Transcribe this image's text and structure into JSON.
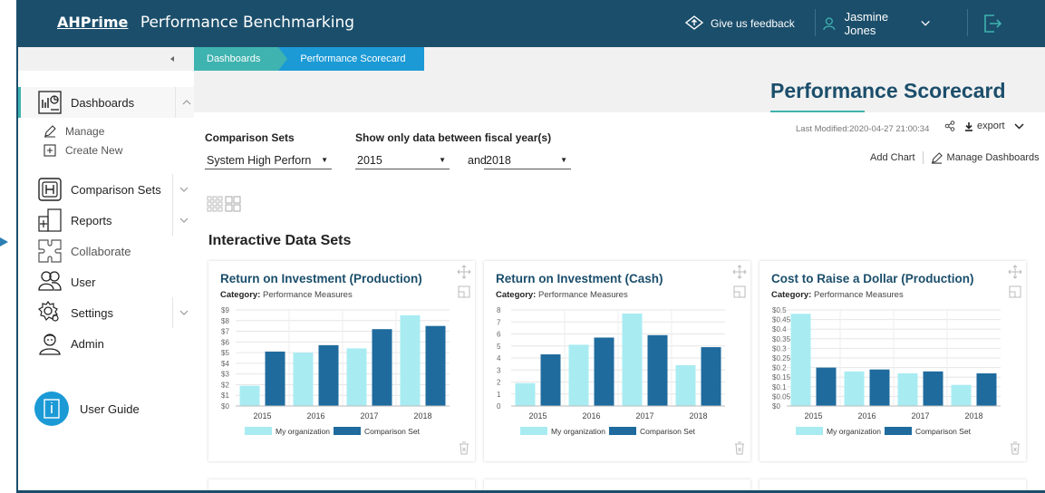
{
  "header": {
    "brand_logo": "AHPrime",
    "app_title": "Performance Benchmarking",
    "feedback_label": "Give us feedback",
    "user_name": "Jasmine Jones"
  },
  "breadcrumb": [
    "Dashboards",
    "Performance Scorecard"
  ],
  "sidebar": {
    "dashboards_label": "Dashboards",
    "manage_label": "Manage",
    "create_new_label": "Create New",
    "comparison_sets_label": "Comparison Sets",
    "reports_label": "Reports",
    "collaborate_label": "Collaborate",
    "user_label": "User",
    "settings_label": "Settings",
    "admin_label": "Admin",
    "user_guide_label": "User Guide"
  },
  "page": {
    "title": "Performance Scorecard",
    "last_modified": "Last Modified:2020-04-27 21:00:34",
    "export_label": "export",
    "add_chart_label": "Add Chart",
    "manage_dashboards_label": "Manage Dashboards",
    "section_title": "Interactive Data Sets"
  },
  "filters": {
    "comparison_label": "Comparison Sets",
    "comparison_value": "System High Perforn",
    "year_label": "Show only data between fiscal year(s)",
    "year_from": "2015",
    "and_label": "and",
    "year_to": "2018"
  },
  "colors": {
    "header": "#1b4e6b",
    "teal": "#3fb3b0",
    "blue": "#1b9ad6",
    "my_org": "#a8ecf2",
    "comparison": "#1f6b9e"
  },
  "chart_data": [
    {
      "type": "bar",
      "title": "Return on Investment (Production)",
      "category_label": "Category:",
      "category_value": "Performance Measures",
      "categories": [
        "2015",
        "2016",
        "2017",
        "2018"
      ],
      "series": [
        {
          "name": "My organization",
          "values": [
            1.9,
            5.0,
            5.4,
            8.5
          ]
        },
        {
          "name": "Comparison Set",
          "values": [
            5.1,
            5.7,
            7.2,
            7.5
          ]
        }
      ],
      "ylim": [
        0,
        9
      ],
      "yticks": [
        0,
        1,
        2,
        3,
        4,
        5,
        6,
        7,
        8,
        9
      ],
      "ytick_labels": [
        "$0",
        "$1",
        "$2",
        "$3",
        "$4",
        "$5",
        "$6",
        "$7",
        "$8",
        "$9"
      ],
      "legend": "bottom"
    },
    {
      "type": "bar",
      "title": "Return on Investment (Cash)",
      "category_label": "Category:",
      "category_value": "Performance Measures",
      "categories": [
        "2015",
        "2016",
        "2017",
        "2018"
      ],
      "series": [
        {
          "name": "My organization",
          "values": [
            1.9,
            5.1,
            7.7,
            3.4
          ]
        },
        {
          "name": "Comparison Set",
          "values": [
            4.3,
            5.7,
            5.9,
            4.9
          ]
        }
      ],
      "ylim": [
        0,
        8
      ],
      "yticks": [
        0,
        1,
        2,
        3,
        4,
        5,
        6,
        7,
        8
      ],
      "ytick_labels": [
        "0",
        "1",
        "2",
        "3",
        "4",
        "5",
        "6",
        "7",
        "8"
      ],
      "legend": "bottom"
    },
    {
      "type": "bar",
      "title": "Cost to Raise a Dollar (Production)",
      "category_label": "Category:",
      "category_value": "Performance Measures",
      "categories": [
        "2015",
        "2016",
        "2017",
        "2018"
      ],
      "series": [
        {
          "name": "My organization",
          "values": [
            0.48,
            0.18,
            0.17,
            0.11
          ]
        },
        {
          "name": "Comparison Set",
          "values": [
            0.2,
            0.19,
            0.18,
            0.17
          ]
        }
      ],
      "ylim": [
        0,
        0.5
      ],
      "yticks": [
        0,
        0.05,
        0.1,
        0.15,
        0.2,
        0.25,
        0.3,
        0.35,
        0.4,
        0.45,
        0.5
      ],
      "ytick_labels": [
        "$0",
        "$0.05",
        "$0.1",
        "$0.15",
        "$0.2",
        "$0.25",
        "$0.3",
        "$0.35",
        "$0.4",
        "$0.45",
        "$0.5"
      ],
      "legend": "bottom"
    }
  ]
}
